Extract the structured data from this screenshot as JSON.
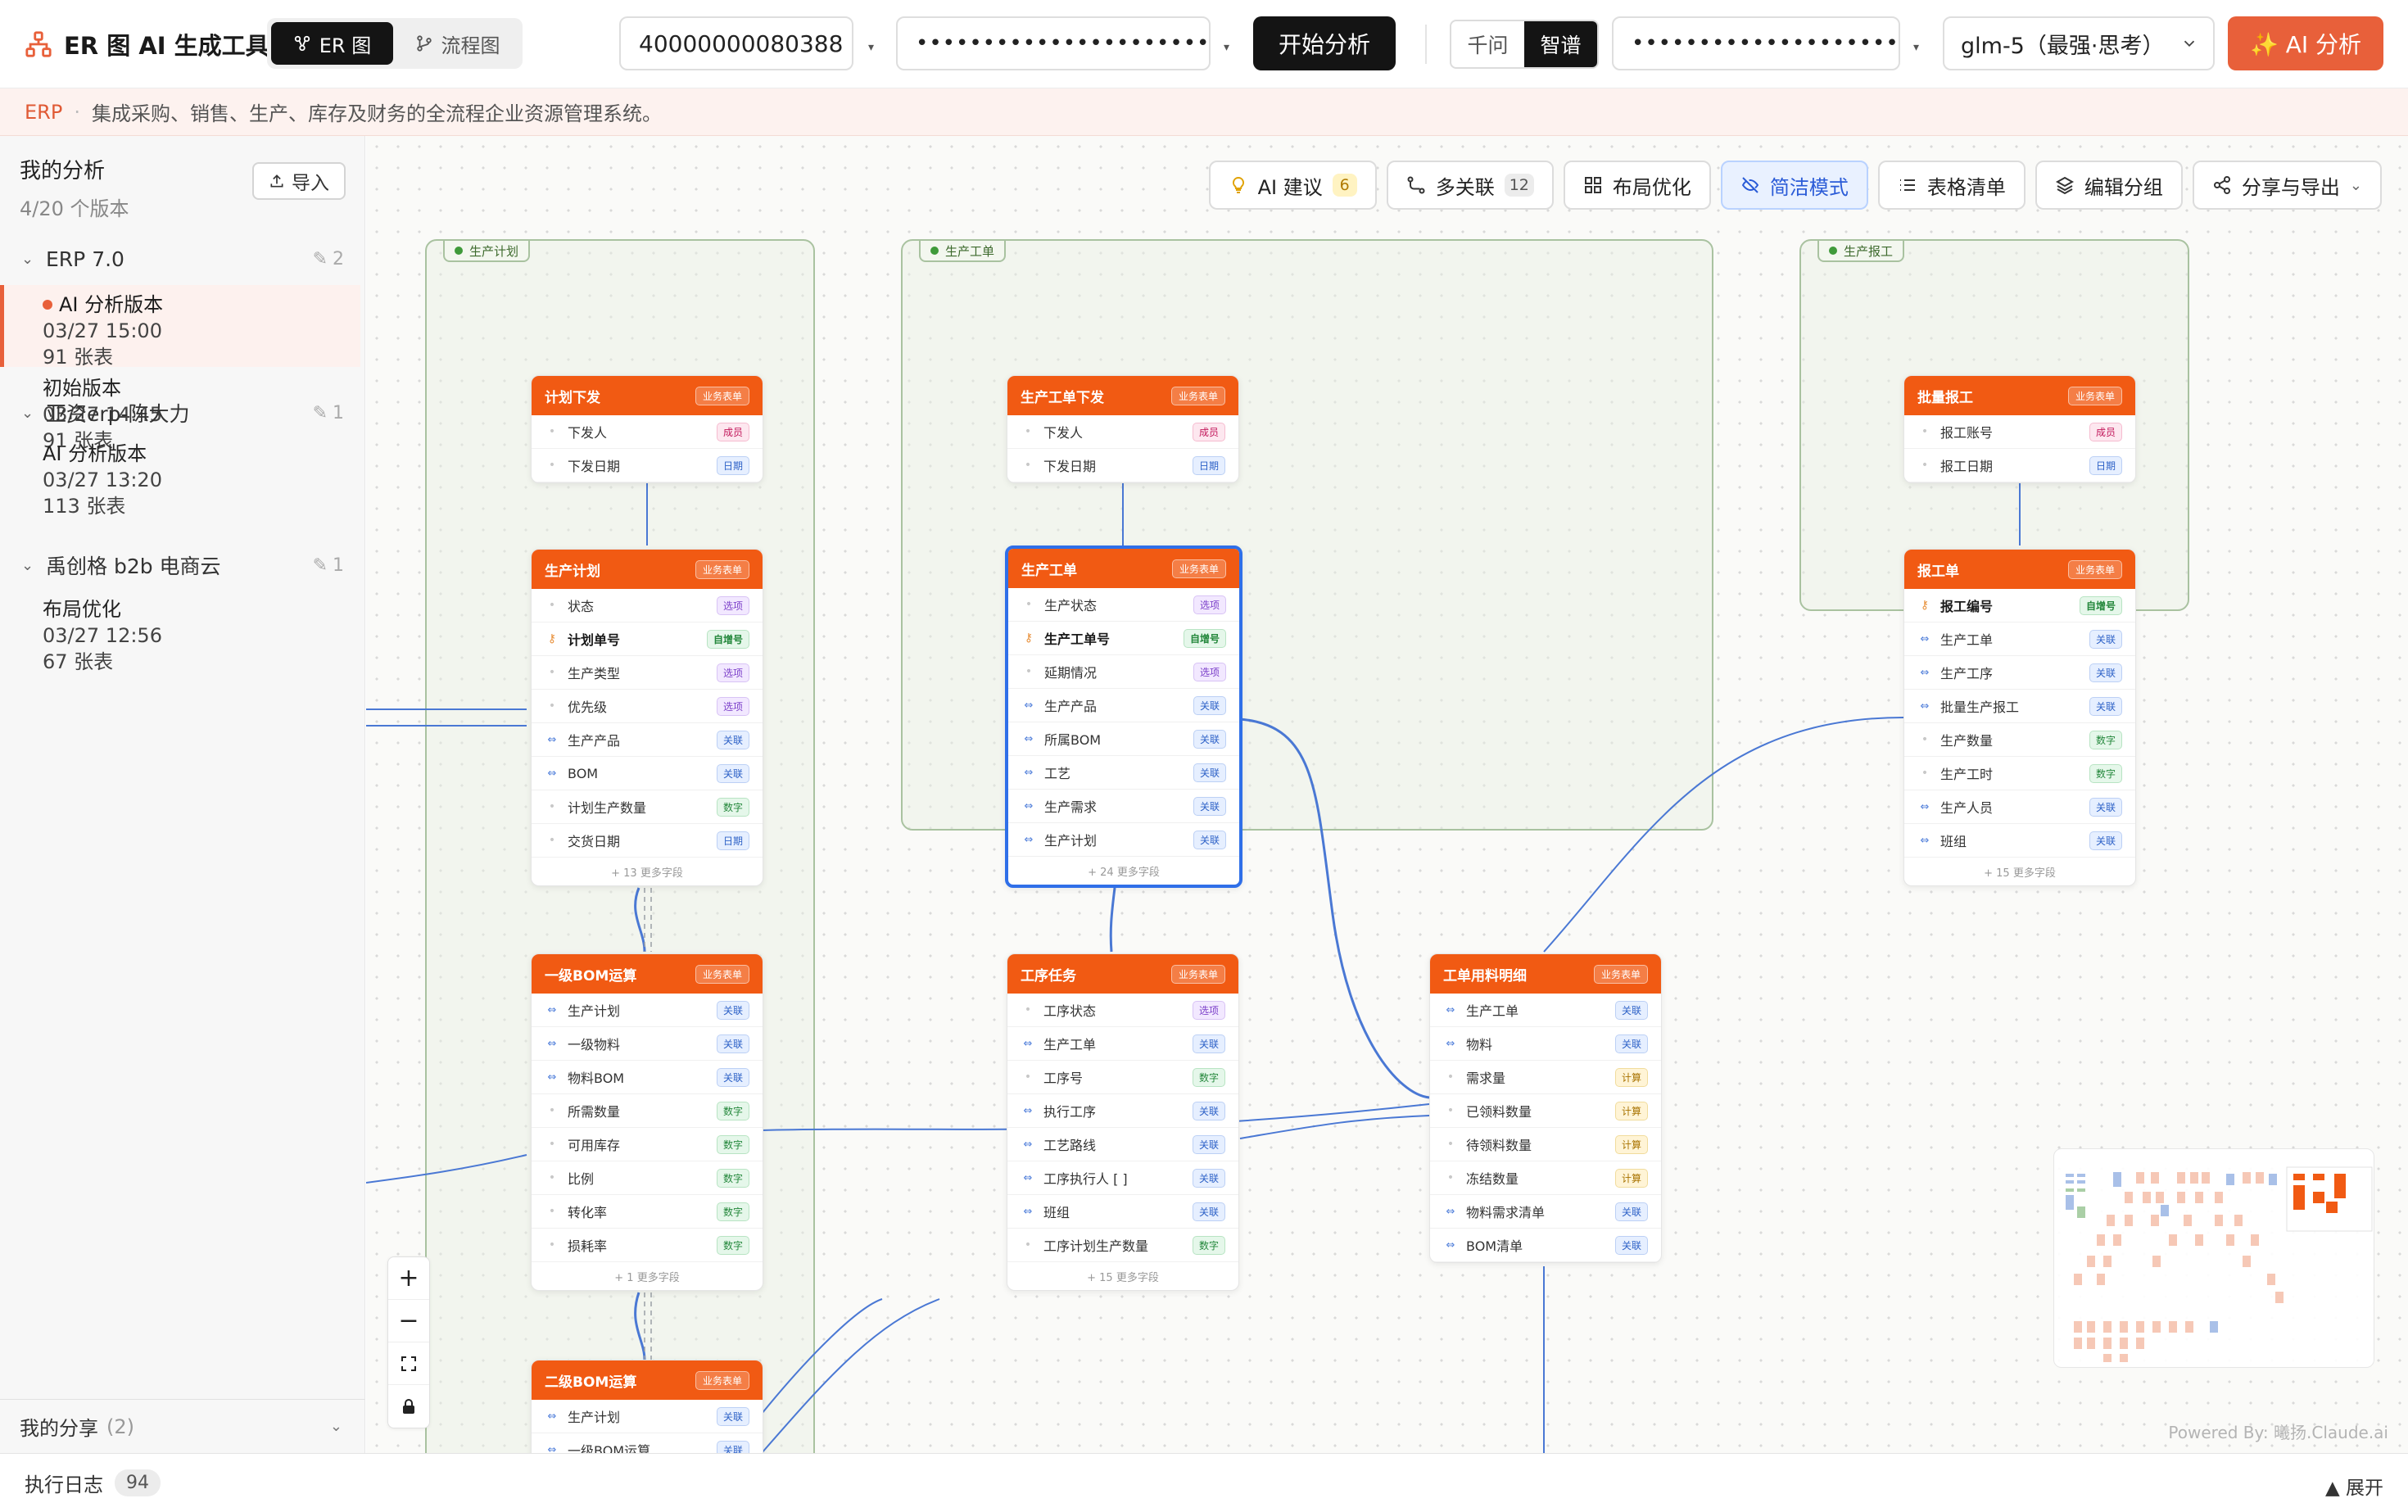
{
  "app": {
    "title": "ER 图 AI 生成工具"
  },
  "view_tabs": [
    {
      "label": "ER 图"
    },
    {
      "label": "流程图"
    }
  ],
  "inputs": {
    "app_id": "40000000080388",
    "token_mask": "••••••••••••••••••••••••••",
    "analyze_label": "开始分析",
    "provider_options": [
      "千问",
      "智谱"
    ],
    "api_key_mask": "••••••••••••••••••••••••",
    "model": "glm-5（最强·思考）",
    "ai_button": "✨ AI 分析"
  },
  "banner": {
    "tag": "ERP",
    "sep": "·",
    "desc": "集成采购、销售、生产、库存及财务的全流程企业资源管理系统。"
  },
  "sidebar": {
    "title": "我的分析",
    "subtitle": "4/20 个版本",
    "import_label": "导入",
    "groups": [
      {
        "name": "ERP 7.0",
        "count": "2",
        "versions": [
          {
            "name": "AI 分析版本",
            "time": "03/27 15:00",
            "tables": "91 张表"
          },
          {
            "name": "初始版本",
            "time": "03/27 14:45",
            "tables": "91 张表"
          }
        ]
      },
      {
        "name": "亚资erp-陈大力",
        "count": "1",
        "versions": [
          {
            "name": "AI 分析版本",
            "time": "03/27 13:20",
            "tables": "113 张表"
          }
        ]
      },
      {
        "name": "禹创格 b2b 电商云",
        "count": "1",
        "versions": [
          {
            "name": "布局优化",
            "time": "03/27 12:56",
            "tables": "67 张表"
          }
        ]
      }
    ],
    "share_label": "我的分享",
    "share_count": "(2)"
  },
  "toolbar": [
    {
      "label": "AI 建议",
      "badge": "6"
    },
    {
      "label": "多关联",
      "badge": "12"
    },
    {
      "label": "布局优化"
    },
    {
      "label": "简洁模式"
    },
    {
      "label": "表格清单"
    },
    {
      "label": "编辑分组"
    },
    {
      "label": "分享与导出"
    }
  ],
  "groups": [
    {
      "label": "生产计划"
    },
    {
      "label": "生产工单"
    },
    {
      "label": "生产报工"
    }
  ],
  "types": {
    "member": "成员",
    "date": "日期",
    "option": "选项",
    "auto": "自增号",
    "rel": "关联",
    "num": "数字",
    "calc": "计算"
  },
  "tables": [
    {
      "name": "计划下发",
      "badge": "业务表单",
      "fields": [
        {
          "n": "下发人",
          "t": "成员",
          "k": "member"
        },
        {
          "n": "下发日期",
          "t": "日期",
          "k": "date"
        }
      ]
    },
    {
      "name": "生产计划",
      "badge": "业务表单",
      "more": "+ 13 更多字段",
      "fields": [
        {
          "n": "状态",
          "t": "选项",
          "k": "option"
        },
        {
          "n": "计划单号",
          "t": "自增号",
          "k": "auto",
          "pk": true
        },
        {
          "n": "生产类型",
          "t": "选项",
          "k": "option"
        },
        {
          "n": "优先级",
          "t": "选项",
          "k": "option"
        },
        {
          "n": "生产产品",
          "t": "关联",
          "k": "rel"
        },
        {
          "n": "BOM",
          "t": "关联",
          "k": "rel"
        },
        {
          "n": "计划生产数量",
          "t": "数字",
          "k": "num"
        },
        {
          "n": "交货日期",
          "t": "日期",
          "k": "date"
        }
      ]
    },
    {
      "name": "一级BOM运算",
      "badge": "业务表单",
      "more": "+ 1 更多字段",
      "fields": [
        {
          "n": "生产计划",
          "t": "关联",
          "k": "rel"
        },
        {
          "n": "一级物料",
          "t": "关联",
          "k": "rel"
        },
        {
          "n": "物料BOM",
          "t": "关联",
          "k": "rel"
        },
        {
          "n": "所需数量",
          "t": "数字",
          "k": "num"
        },
        {
          "n": "可用库存",
          "t": "数字",
          "k": "num"
        },
        {
          "n": "比例",
          "t": "数字",
          "k": "num"
        },
        {
          "n": "转化率",
          "t": "数字",
          "k": "num"
        },
        {
          "n": "损耗率",
          "t": "数字",
          "k": "num"
        }
      ]
    },
    {
      "name": "二级BOM运算",
      "badge": "业务表单",
      "fields": [
        {
          "n": "生产计划",
          "t": "关联",
          "k": "rel"
        },
        {
          "n": "一级BOM运算",
          "t": "关联",
          "k": "rel"
        }
      ]
    },
    {
      "name": "生产工单下发",
      "badge": "业务表单",
      "fields": [
        {
          "n": "下发人",
          "t": "成员",
          "k": "member"
        },
        {
          "n": "下发日期",
          "t": "日期",
          "k": "date"
        }
      ]
    },
    {
      "name": "生产工单",
      "badge": "业务表单",
      "more": "+ 24 更多字段",
      "fields": [
        {
          "n": "生产状态",
          "t": "选项",
          "k": "option"
        },
        {
          "n": "生产工单号",
          "t": "自增号",
          "k": "auto",
          "pk": true
        },
        {
          "n": "延期情况",
          "t": "选项",
          "k": "option"
        },
        {
          "n": "生产产品",
          "t": "关联",
          "k": "rel"
        },
        {
          "n": "所属BOM",
          "t": "关联",
          "k": "rel"
        },
        {
          "n": "工艺",
          "t": "关联",
          "k": "rel"
        },
        {
          "n": "生产需求",
          "t": "关联",
          "k": "rel"
        },
        {
          "n": "生产计划",
          "t": "关联",
          "k": "rel"
        }
      ]
    },
    {
      "name": "工序任务",
      "badge": "业务表单",
      "more": "+ 15 更多字段",
      "fields": [
        {
          "n": "工序状态",
          "t": "选项",
          "k": "option"
        },
        {
          "n": "生产工单",
          "t": "关联",
          "k": "rel"
        },
        {
          "n": "工序号",
          "t": "数字",
          "k": "num"
        },
        {
          "n": "执行工序",
          "t": "关联",
          "k": "rel"
        },
        {
          "n": "工艺路线",
          "t": "关联",
          "k": "rel"
        },
        {
          "n": "工序执行人 [ ]",
          "t": "关联",
          "k": "rel"
        },
        {
          "n": "班组",
          "t": "关联",
          "k": "rel"
        },
        {
          "n": "工序计划生产数量",
          "t": "数字",
          "k": "num"
        }
      ]
    },
    {
      "name": "工单用料明细",
      "badge": "业务表单",
      "fields": [
        {
          "n": "生产工单",
          "t": "关联",
          "k": "rel"
        },
        {
          "n": "物料",
          "t": "关联",
          "k": "rel"
        },
        {
          "n": "需求量",
          "t": "计算",
          "k": "calc"
        },
        {
          "n": "已领料数量",
          "t": "计算",
          "k": "calc"
        },
        {
          "n": "待领料数量",
          "t": "计算",
          "k": "calc"
        },
        {
          "n": "冻结数量",
          "t": "计算",
          "k": "calc"
        },
        {
          "n": "物料需求清单",
          "t": "关联",
          "k": "rel"
        },
        {
          "n": "BOM清单",
          "t": "关联",
          "k": "rel"
        }
      ]
    },
    {
      "name": "批量报工",
      "badge": "业务表单",
      "fields": [
        {
          "n": "报工账号",
          "t": "成员",
          "k": "member"
        },
        {
          "n": "报工日期",
          "t": "日期",
          "k": "date"
        }
      ]
    },
    {
      "name": "报工单",
      "badge": "业务表单",
      "more": "+ 15 更多字段",
      "fields": [
        {
          "n": "报工编号",
          "t": "自增号",
          "k": "auto",
          "pk": true
        },
        {
          "n": "生产工单",
          "t": "关联",
          "k": "rel"
        },
        {
          "n": "生产工序",
          "t": "关联",
          "k": "rel"
        },
        {
          "n": "批量生产报工",
          "t": "关联",
          "k": "rel"
        },
        {
          "n": "生产数量",
          "t": "数字",
          "k": "num"
        },
        {
          "n": "生产工时",
          "t": "数字",
          "k": "num"
        },
        {
          "n": "生产人员",
          "t": "关联",
          "k": "rel"
        },
        {
          "n": "班组",
          "t": "关联",
          "k": "rel"
        }
      ]
    }
  ],
  "colors": {
    "accent": "#e8603a",
    "table_header": "#f15a13",
    "selected": "#2f6fe8",
    "link": "#4a78d4"
  },
  "powered": "Powered By: 曦扬.Claude.ai",
  "footer": {
    "log_label": "执行日志",
    "log_count": "94",
    "expand_label": "▲ 展开"
  }
}
